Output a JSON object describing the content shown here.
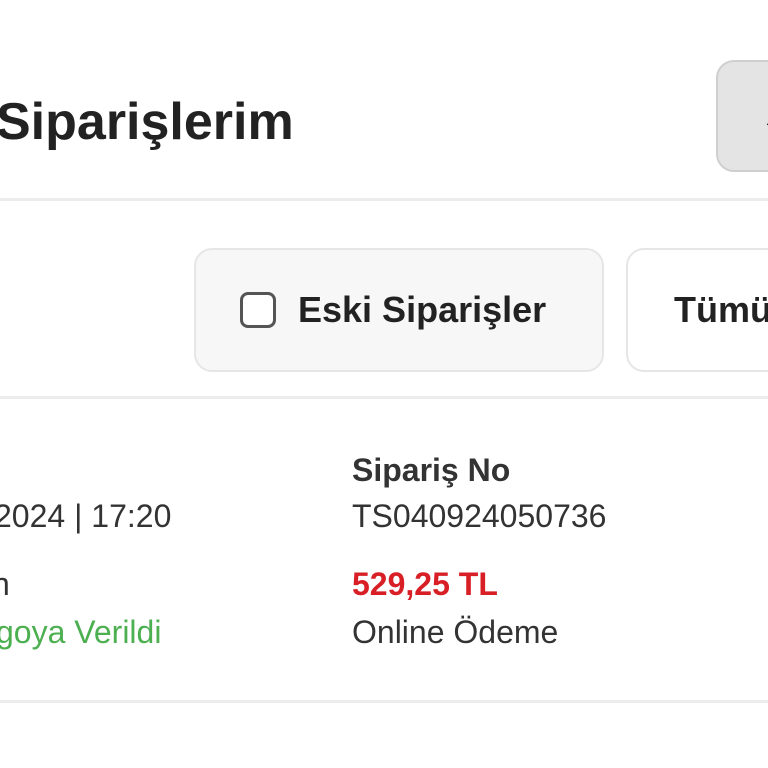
{
  "header": {
    "title": "Siparişlerim",
    "action_icon": "back-arrow-icon"
  },
  "filters": {
    "old_orders_label": "Eski Siparişler",
    "old_orders_checked": false,
    "all_label": "Tümü"
  },
  "order": {
    "date_time": "2024 | 17:20",
    "left_label_fragment": "n",
    "status": "goya Verildi",
    "order_no_label": "Sipariş No",
    "order_no": "TS040924050736",
    "total": "529,25 TL",
    "payment_method": "Online Ödeme"
  },
  "colors": {
    "price": "#d81f26",
    "status": "#4caf50",
    "filter_active_bg": "#f7f7f7",
    "action_button_bg": "#e4e4e4"
  }
}
